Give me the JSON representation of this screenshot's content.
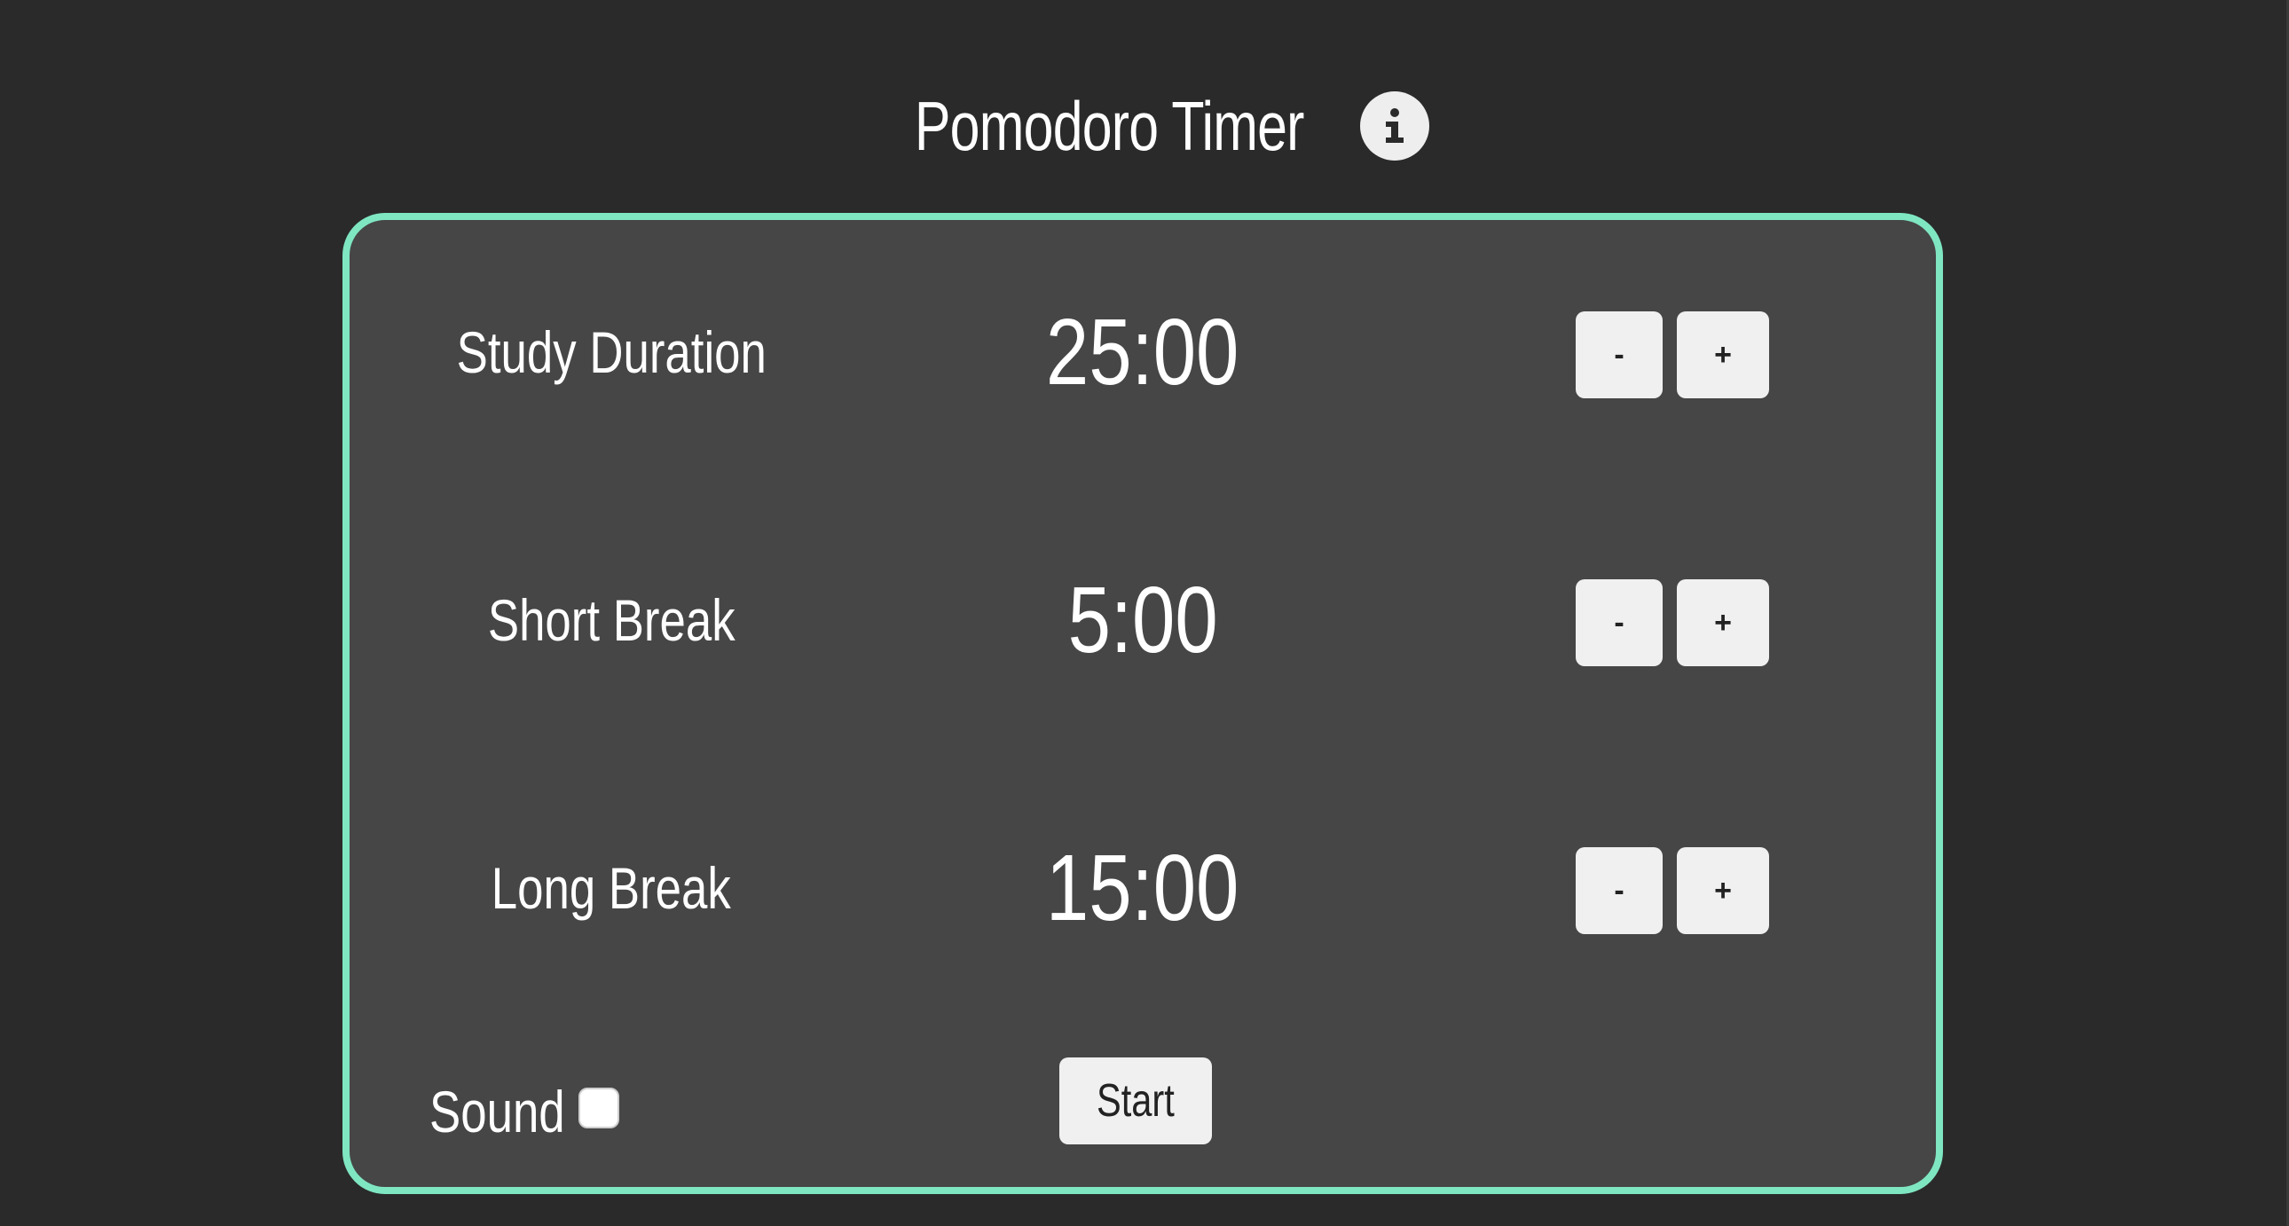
{
  "header": {
    "title": "Pomodoro Timer",
    "info_icon": "info-icon"
  },
  "timers": [
    {
      "label": "Study Duration",
      "value": "25:00",
      "decrement_label": "-",
      "increment_label": "+"
    },
    {
      "label": "Short Break",
      "value": "5:00",
      "decrement_label": "-",
      "increment_label": "+"
    },
    {
      "label": "Long Break",
      "value": "15:00",
      "decrement_label": "-",
      "increment_label": "+"
    }
  ],
  "sound": {
    "label": "Sound",
    "checked": false
  },
  "start": {
    "label": "Start"
  },
  "colors": {
    "background": "#2a2a2a",
    "card": "#464646",
    "accent_border": "#7fe6c2",
    "button": "#f0f0f0",
    "text": "#ffffff"
  }
}
